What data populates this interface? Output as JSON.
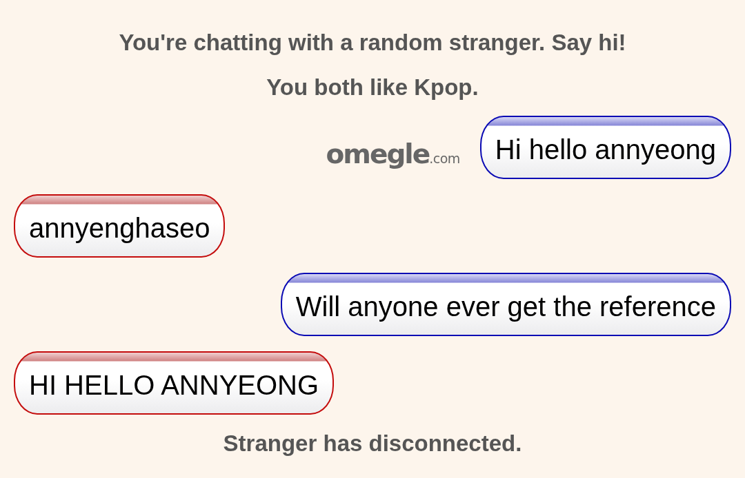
{
  "status_top": [
    "You're chatting with a random stranger. Say hi!",
    "You both like Kpop."
  ],
  "logo": {
    "name": "omegle",
    "suffix": ".com"
  },
  "messages": [
    {
      "kind": "sent",
      "text": "Hi hello annyeong"
    },
    {
      "kind": "received",
      "text": "annyenghaseo"
    },
    {
      "kind": "sent",
      "text": "Will anyone ever get the reference"
    },
    {
      "kind": "received",
      "text": "HI HELLO ANNYEONG"
    }
  ],
  "status_bottom": "Stranger has disconnected."
}
